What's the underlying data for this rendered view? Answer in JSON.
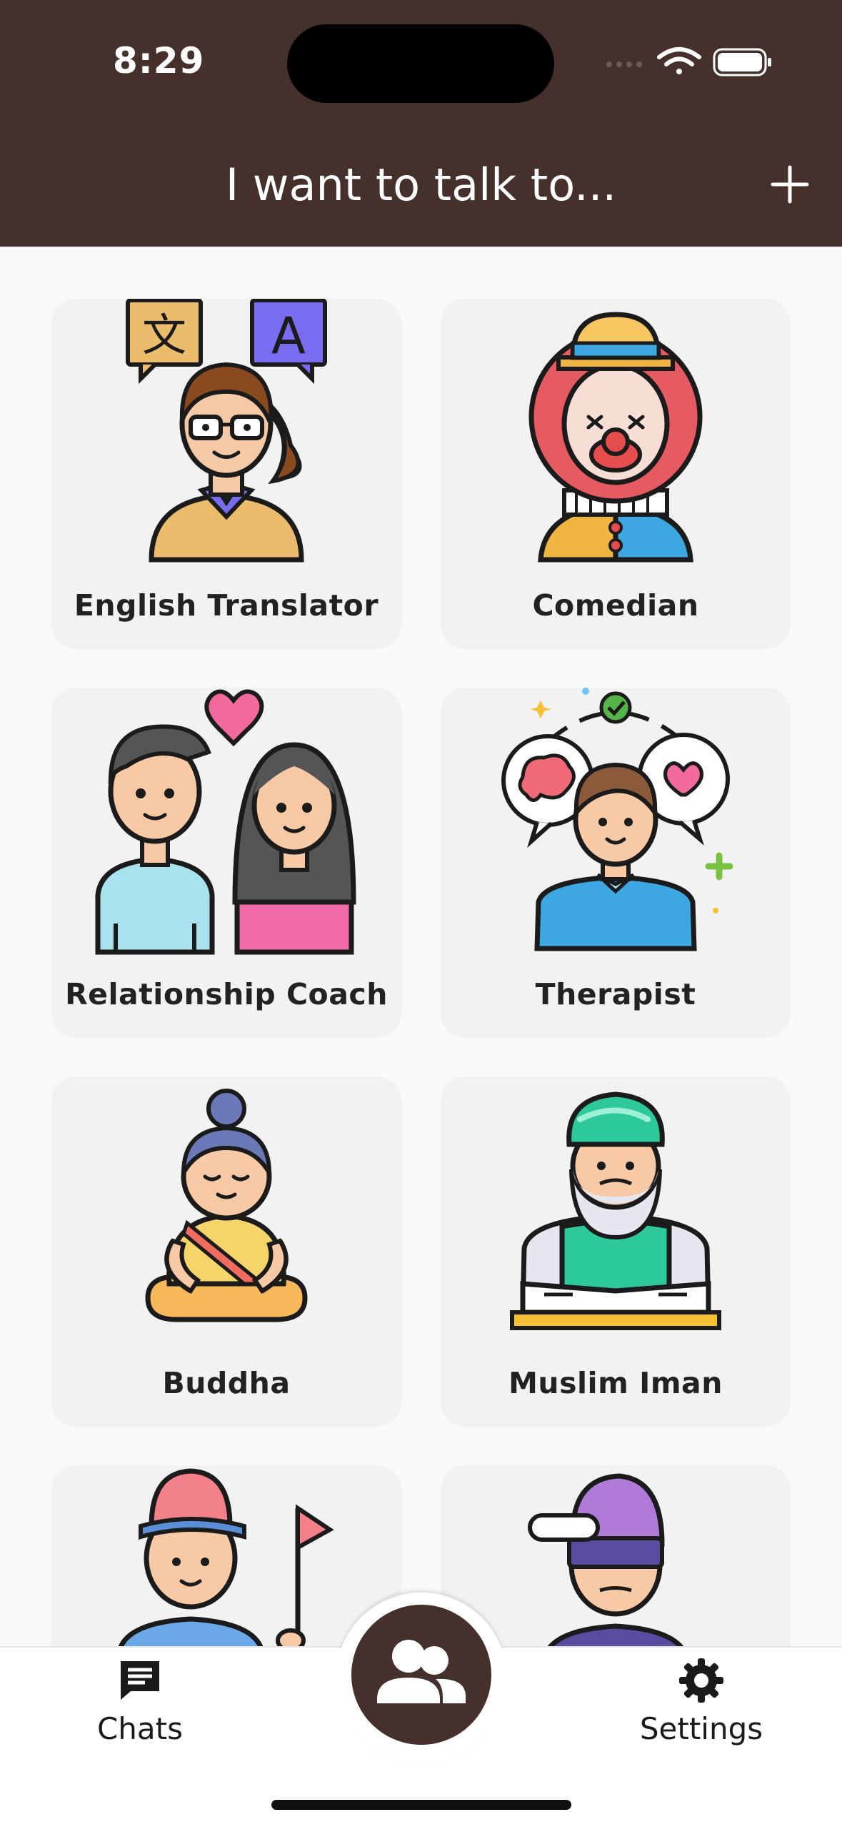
{
  "status_bar": {
    "time": "8:29"
  },
  "header": {
    "title": "I want to talk to..."
  },
  "personas": [
    {
      "name": "English Translator"
    },
    {
      "name": "Comedian"
    },
    {
      "name": "Relationship Coach"
    },
    {
      "name": "Therapist"
    },
    {
      "name": "Buddha"
    },
    {
      "name": "Muslim Iman"
    },
    {
      "name": ""
    },
    {
      "name": ""
    }
  ],
  "persona_icons": [
    "translator-icon",
    "clown-icon",
    "couple-icon",
    "therapist-icon",
    "buddha-icon",
    "imam-icon",
    "golfer-icon",
    "hipster-icon"
  ],
  "tabs": {
    "chats": {
      "label": "Chats",
      "icon": "chat-bubble-icon"
    },
    "center": {
      "icon": "people-icon"
    },
    "settings": {
      "label": "Settings",
      "icon": "gear-icon"
    }
  },
  "colors": {
    "brand": "#46302b",
    "background": "#f9f9f9",
    "card": "#f2f2f2"
  }
}
